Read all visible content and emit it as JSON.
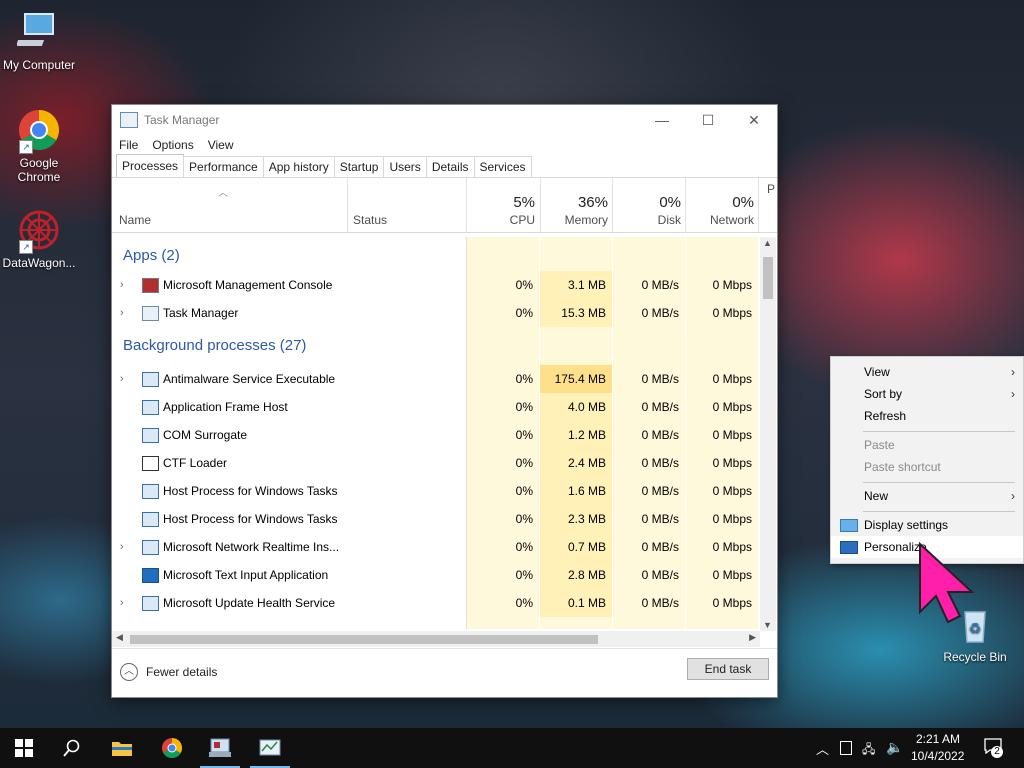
{
  "desktop": {
    "icons": [
      {
        "label": "My Computer"
      },
      {
        "label": "Google Chrome"
      },
      {
        "label": "DataWagon..."
      },
      {
        "label": "Recycle Bin"
      }
    ]
  },
  "task_manager": {
    "title": "Task Manager",
    "menu": [
      "File",
      "Options",
      "View"
    ],
    "tabs": [
      "Processes",
      "Performance",
      "App history",
      "Startup",
      "Users",
      "Details",
      "Services"
    ],
    "columns": {
      "name": "Name",
      "status": "Status",
      "cpu": {
        "label": "CPU",
        "pct": "5%"
      },
      "memory": {
        "label": "Memory",
        "pct": "36%"
      },
      "disk": {
        "label": "Disk",
        "pct": "0%"
      },
      "network": {
        "label": "Network",
        "pct": "0%"
      },
      "power_partial": "P"
    },
    "groups": {
      "apps": "Apps (2)",
      "background": "Background processes (27)"
    },
    "apps": [
      {
        "name": "Microsoft Management Console",
        "cpu": "0%",
        "memory": "3.1 MB",
        "disk": "0 MB/s",
        "network": "0 Mbps"
      },
      {
        "name": "Task Manager",
        "cpu": "0%",
        "memory": "15.3 MB",
        "disk": "0 MB/s",
        "network": "0 Mbps"
      }
    ],
    "background": [
      {
        "name": "Antimalware Service Executable",
        "cpu": "0%",
        "memory": "175.4 MB",
        "disk": "0 MB/s",
        "network": "0 Mbps"
      },
      {
        "name": "Application Frame Host",
        "cpu": "0%",
        "memory": "4.0 MB",
        "disk": "0 MB/s",
        "network": "0 Mbps"
      },
      {
        "name": "COM Surrogate",
        "cpu": "0%",
        "memory": "1.2 MB",
        "disk": "0 MB/s",
        "network": "0 Mbps"
      },
      {
        "name": "CTF Loader",
        "cpu": "0%",
        "memory": "2.4 MB",
        "disk": "0 MB/s",
        "network": "0 Mbps"
      },
      {
        "name": "Host Process for Windows Tasks",
        "cpu": "0%",
        "memory": "1.6 MB",
        "disk": "0 MB/s",
        "network": "0 Mbps"
      },
      {
        "name": "Host Process for Windows Tasks",
        "cpu": "0%",
        "memory": "2.3 MB",
        "disk": "0 MB/s",
        "network": "0 Mbps"
      },
      {
        "name": "Microsoft Network Realtime Ins...",
        "cpu": "0%",
        "memory": "0.7 MB",
        "disk": "0 MB/s",
        "network": "0 Mbps"
      },
      {
        "name": "Microsoft Text Input Application",
        "cpu": "0%",
        "memory": "2.8 MB",
        "disk": "0 MB/s",
        "network": "0 Mbps"
      },
      {
        "name": "Microsoft Update Health Service",
        "cpu": "0%",
        "memory": "0.1 MB",
        "disk": "0 MB/s",
        "network": "0 Mbps"
      }
    ],
    "fewer_details": "Fewer details",
    "end_task": "End task"
  },
  "context_menu": {
    "view": "View",
    "sort_by": "Sort by",
    "refresh": "Refresh",
    "paste": "Paste",
    "paste_shortcut": "Paste shortcut",
    "new": "New",
    "display_settings": "Display settings",
    "personalize": "Personalize"
  },
  "taskbar": {
    "time": "2:21 AM",
    "date": "10/4/2022",
    "notifications": "2"
  },
  "colors": {
    "heat_light": "#fff9dc",
    "heat_mid": "#fff1b8",
    "heat_high": "#ffe08a",
    "group_blue": "#2a5aa8",
    "cursor_pink": "#ff1fa8"
  }
}
